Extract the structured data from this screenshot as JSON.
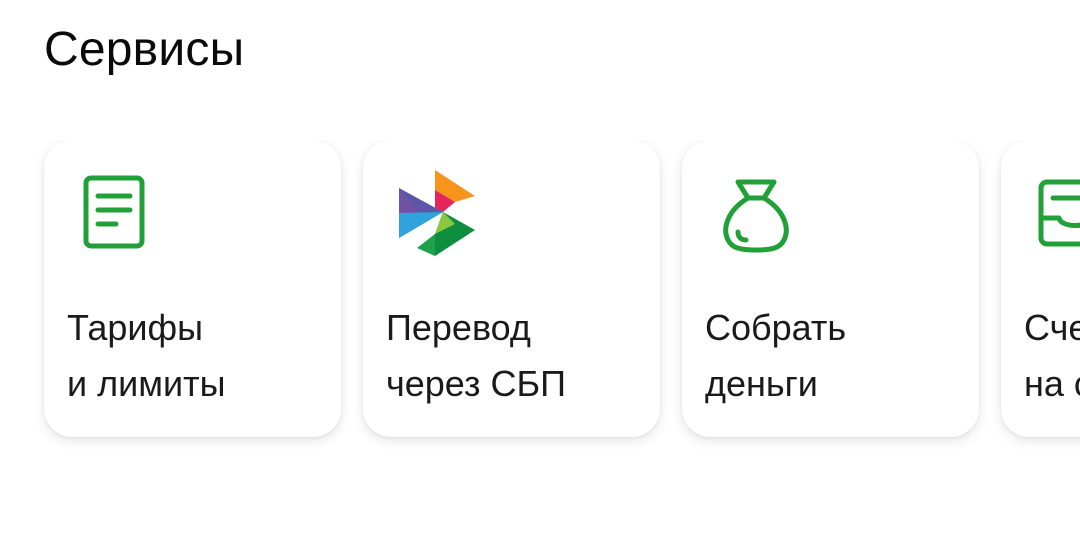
{
  "section": {
    "title": "Сервисы"
  },
  "accent_color": "#21A038",
  "cards": [
    {
      "icon": "document-icon",
      "line1": "Тарифы",
      "line2": "и лимиты"
    },
    {
      "icon": "sbp-logo-icon",
      "line1": "Перевод",
      "line2": "через СБП"
    },
    {
      "icon": "money-bag-icon",
      "line1": "Собрать",
      "line2": "деньги"
    },
    {
      "icon": "invoice-icon",
      "line1": "Сче",
      "line2": "на с"
    }
  ]
}
